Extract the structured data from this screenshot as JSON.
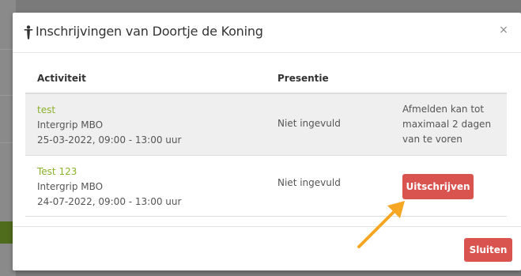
{
  "modal": {
    "title": "Inschrijvingen van Doortje de Koning",
    "close_label": "×"
  },
  "table": {
    "headers": {
      "activity": "Activiteit",
      "presence": "Presentie"
    },
    "rows": [
      {
        "name": "test",
        "organization": "Intergrip MBO",
        "datetime": "25-03-2022, 09:00 - 13:00 uur",
        "presence": "Niet ingevuld",
        "info": "Afmelden kan tot maximaal 2 dagen van te voren"
      },
      {
        "name": "Test 123",
        "organization": "Intergrip MBO",
        "datetime": "24-07-2022, 09:00 - 13:00 uur",
        "presence": "Niet ingevuld",
        "action_label": "Uitschrijven"
      }
    ]
  },
  "footer": {
    "close_button": "Sluiten"
  },
  "colors": {
    "accent_green": "#8ab228",
    "danger_red": "#d9534f",
    "annotation_arrow": "#f5a623"
  }
}
